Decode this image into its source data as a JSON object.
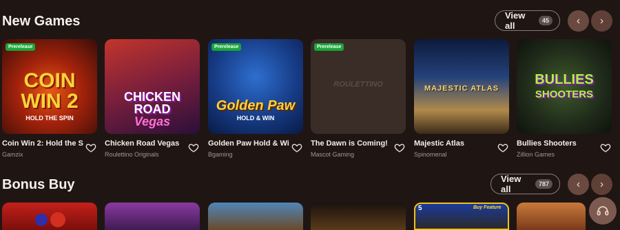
{
  "new_games": {
    "title": "New Games",
    "view_all_label": "View all",
    "count": "45",
    "games": [
      {
        "title": "Coin Win 2: Hold the S...",
        "provider": "Gamzix",
        "prerelease": "Prerelease",
        "art_lines": [
          "COIN",
          "WIN 2",
          "HOLD THE SPIN"
        ]
      },
      {
        "title": "Chicken Road Vegas",
        "provider": "Roulettino Originals",
        "prerelease": "",
        "art_lines": [
          "CHICKEN",
          "ROAD",
          "Vegas"
        ]
      },
      {
        "title": "Golden Paw Hold & Win",
        "provider": "Bgaming",
        "prerelease": "Prerelease",
        "art_lines": [
          "Golden Paw",
          "HOLD & WIN"
        ]
      },
      {
        "title": "The Dawn is Coming!",
        "provider": "Mascot Gaming",
        "prerelease": "Prerelease",
        "art_lines": [
          "ROULETTINO"
        ]
      },
      {
        "title": "Majestic Atlas",
        "provider": "Spinomenal",
        "prerelease": "",
        "art_lines": [
          "MAJESTIC ATLAS"
        ]
      },
      {
        "title": "Bullies Shooters",
        "provider": "Zillion Games",
        "prerelease": "",
        "art_lines": [
          "BULLIES",
          "SHOOTERS"
        ]
      }
    ]
  },
  "bonus_buy": {
    "title": "Bonus Buy",
    "view_all_label": "View all",
    "count": "787",
    "thumbs": [
      {
        "art": "5"
      },
      {
        "art": "Buy Feature"
      }
    ]
  },
  "colors": {
    "background": "#1f1614",
    "prerelease": "#1aa63a",
    "nav_button": "#6a4a40"
  },
  "icons": {
    "prev": "chevron-left-icon",
    "next": "chevron-right-icon",
    "favorite": "heart-icon",
    "support": "headset-icon"
  }
}
